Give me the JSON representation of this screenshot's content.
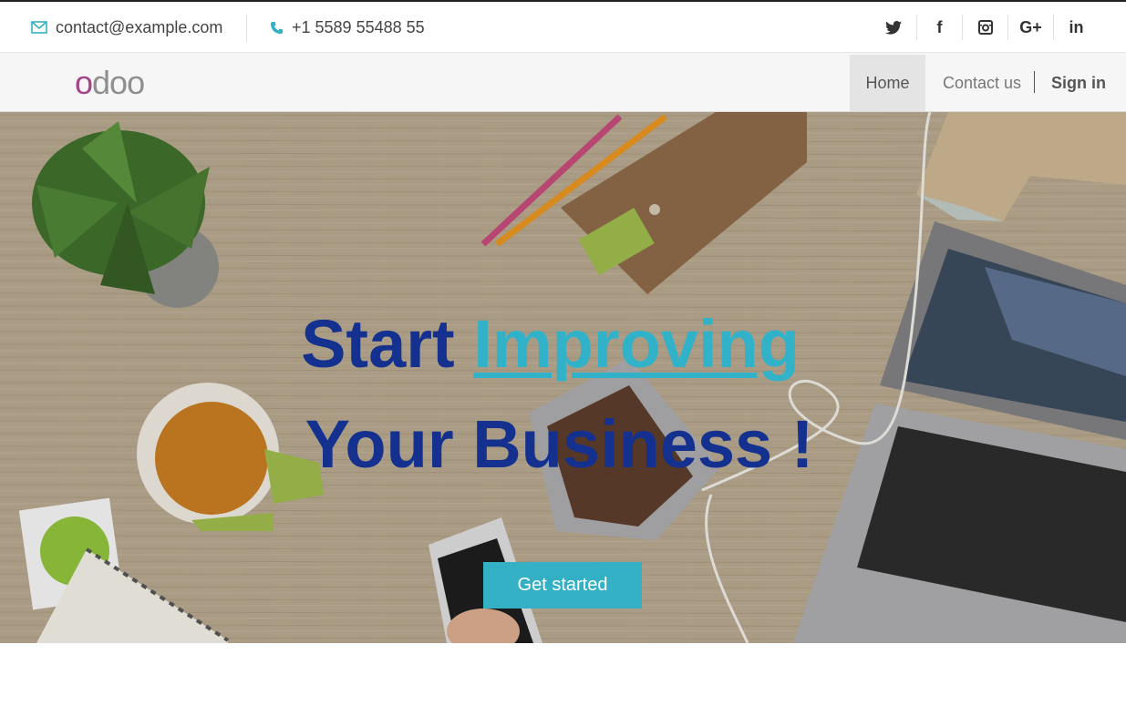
{
  "topbar": {
    "email": "contact@example.com",
    "phone": "+1 5589 55488 55",
    "socials": [
      {
        "name": "twitter-icon",
        "label": ""
      },
      {
        "name": "facebook-icon",
        "label": "f"
      },
      {
        "name": "instagram-icon",
        "label": ""
      },
      {
        "name": "google-plus-icon",
        "label": "G+"
      },
      {
        "name": "linkedin-icon",
        "label": "in"
      }
    ]
  },
  "navbar": {
    "logo": "odoo",
    "home": "Home",
    "contact": "Contact us",
    "signin": "Sign in"
  },
  "hero": {
    "title_start": "Start",
    "title_highlight": "Improving",
    "title_line2": "Your Business !",
    "cta": "Get started"
  },
  "colors": {
    "accent": "#33b0c3",
    "title": "#14318f",
    "logo_o": "#a24689"
  }
}
